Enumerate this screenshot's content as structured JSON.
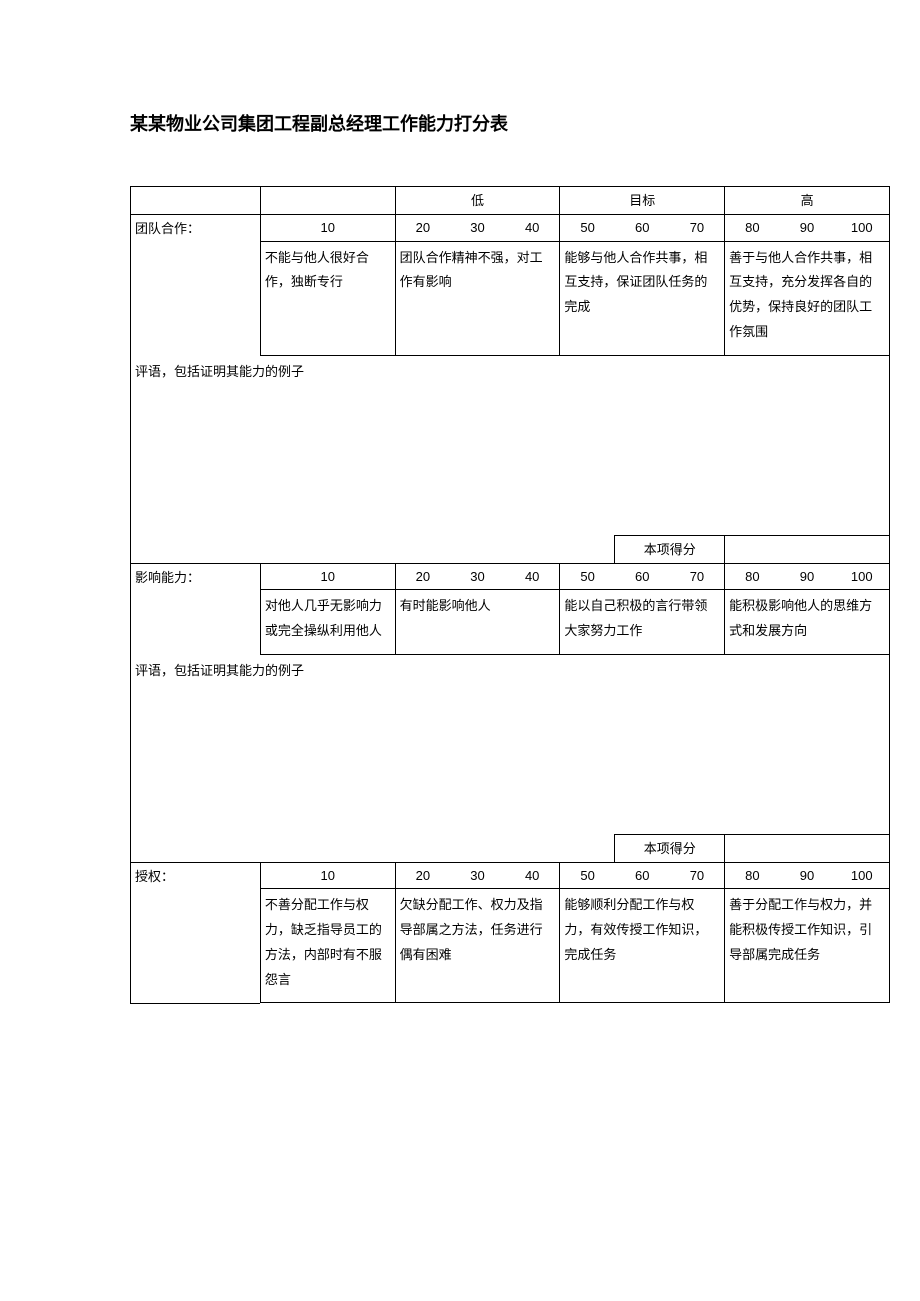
{
  "title": "某某物业公司集团工程副总经理工作能力打分表",
  "header_groups": {
    "low": "低",
    "target": "目标",
    "high": "高"
  },
  "scale": [
    "10",
    "20",
    "30",
    "40",
    "50",
    "60",
    "70",
    "80",
    "90",
    "100"
  ],
  "sections": [
    {
      "label": "团队合作：",
      "desc1": "不能与他人很好合作，独断专行",
      "desc2": "团队合作精神不强，对工作有影响",
      "desc3": "能够与他人合作共事，相互支持，保证团队任务的完成",
      "desc4": "善于与他人合作共事，相互支持，充分发挥各自的优势，保持良好的团队工作氛围",
      "comment_label": "评语，包括证明其能力的例子",
      "score_label": "本项得分"
    },
    {
      "label": "影响能力：",
      "desc1": "对他人几乎无影响力或完全操纵利用他人",
      "desc2": "有时能影响他人",
      "desc3": "能以自己积极的言行带领大家努力工作",
      "desc4": "能积极影响他人的思维方式和发展方向",
      "comment_label": "评语，包括证明其能力的例子",
      "score_label": "本项得分"
    },
    {
      "label": "授权：",
      "desc1": "不善分配工作与权力，缺乏指导员工的方法，内部时有不服怨言",
      "desc2": "欠缺分配工作、权力及指导部属之方法，任务进行偶有困难",
      "desc3": "能够顺利分配工作与权力，有效传授工作知识，完成任务",
      "desc4": "善于分配工作与权力，并能积极传授工作知识，引导部属完成任务"
    }
  ]
}
